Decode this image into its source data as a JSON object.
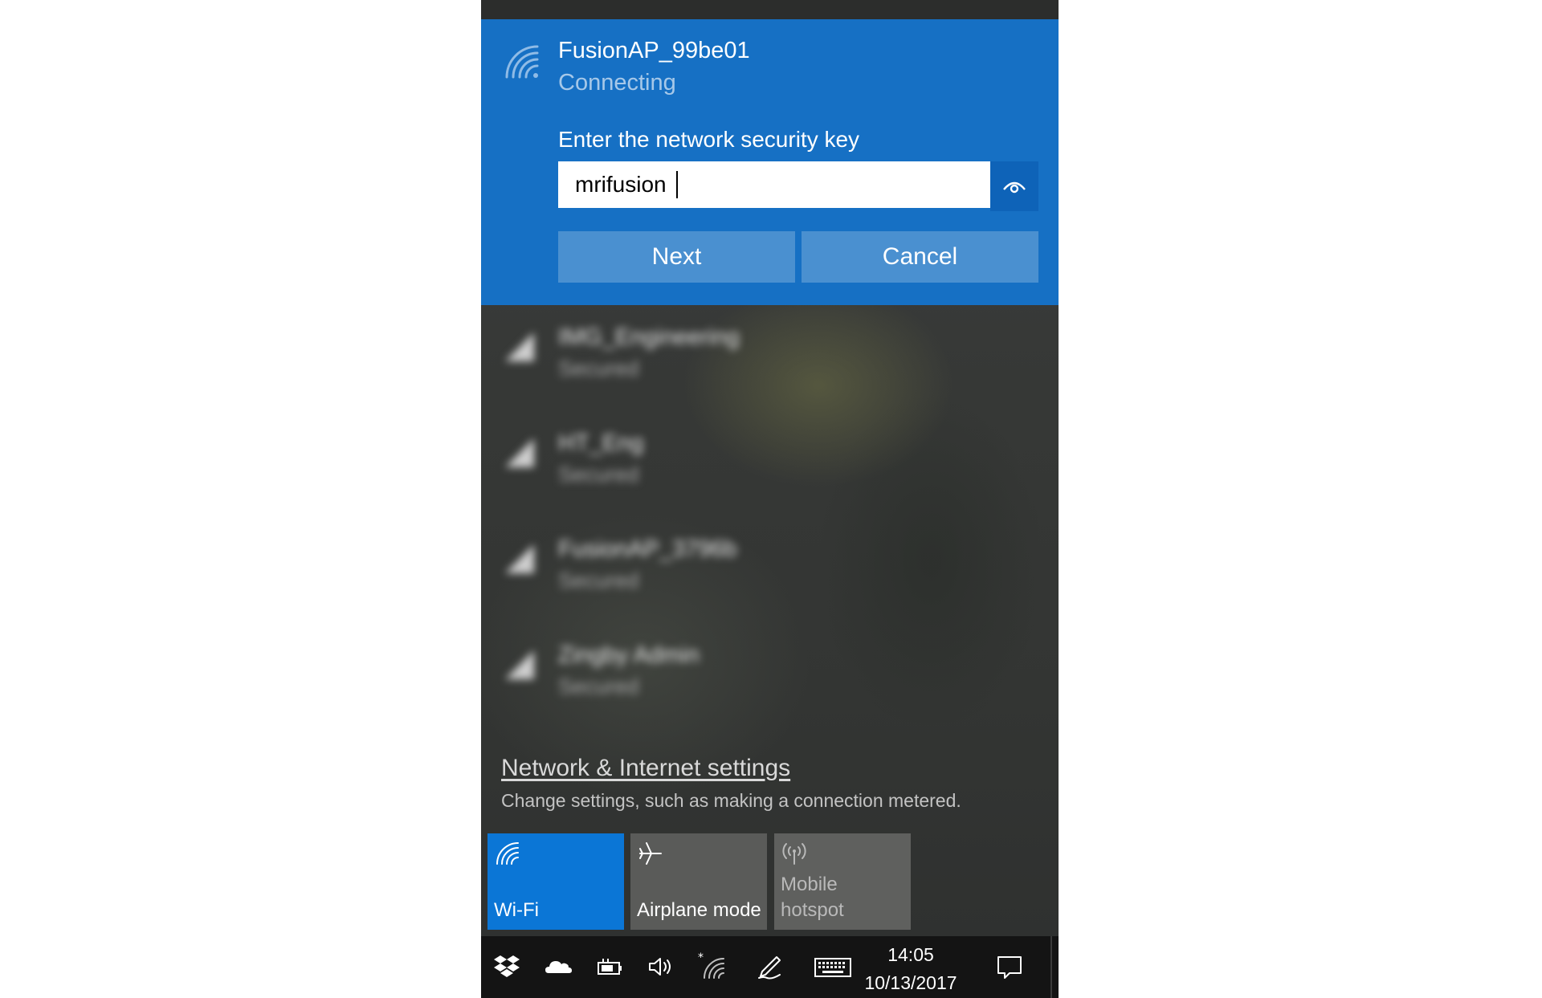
{
  "active_network": {
    "ssid": "FusionAP_99be01",
    "status": "Connecting",
    "key_label": "Enter the network security key",
    "key_value": "mrifusion",
    "next_label": "Next",
    "cancel_label": "Cancel",
    "accent": "#1670c4"
  },
  "networks": [
    {
      "name": "IMG_Engineering",
      "status": "Secured"
    },
    {
      "name": "HT_Eng",
      "status": "Secured"
    },
    {
      "name": "FusionAP_3796b",
      "status": "Secured"
    },
    {
      "name": "Zingby Admin",
      "status": "Secured"
    }
  ],
  "settings": {
    "link_label": "Network & Internet settings",
    "description": "Change settings, such as making a connection metered."
  },
  "quick_actions": [
    {
      "label": "Wi-Fi",
      "icon": "wifi-icon",
      "active": true,
      "color": "#0b76d6"
    },
    {
      "label": "Airplane mode",
      "icon": "airplane-icon",
      "active": false
    },
    {
      "label": "Mobile hotspot",
      "icon": "hotspot-icon",
      "active": false,
      "disabled": true
    }
  ],
  "taskbar": {
    "time": "14:05",
    "date": "10/13/2017",
    "icons": [
      "dropbox-icon",
      "onedrive-icon",
      "power-plug-icon",
      "volume-icon",
      "wifi-icon",
      "pen-icon",
      "keyboard-icon",
      "action-center-icon"
    ]
  }
}
